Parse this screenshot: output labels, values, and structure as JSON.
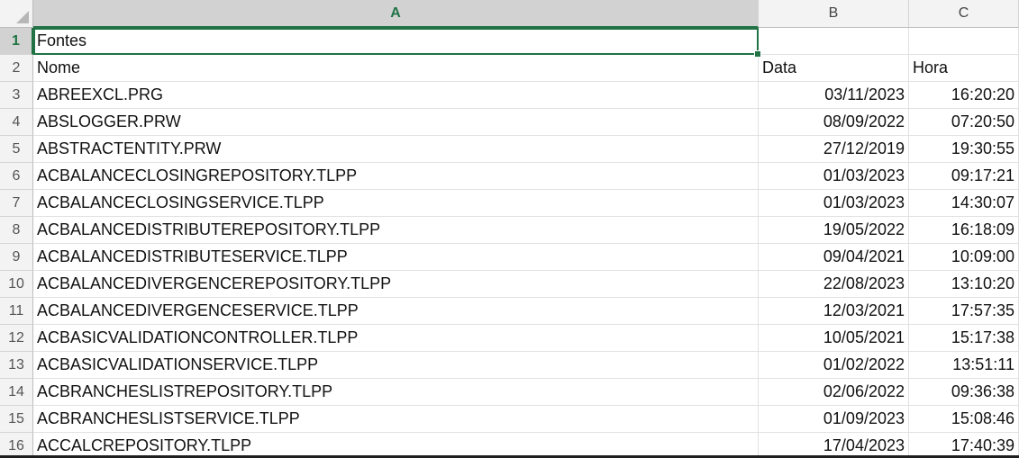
{
  "columns": [
    "A",
    "B",
    "C"
  ],
  "rows": [
    {
      "num": "1",
      "a": "Fontes",
      "b": "",
      "c": ""
    },
    {
      "num": "2",
      "a": "Nome",
      "b": "Data",
      "c": "Hora"
    },
    {
      "num": "3",
      "a": "ABREEXCL.PRG",
      "b": "03/11/2023",
      "c": "16:20:20"
    },
    {
      "num": "4",
      "a": "ABSLOGGER.PRW",
      "b": "08/09/2022",
      "c": "07:20:50"
    },
    {
      "num": "5",
      "a": "ABSTRACTENTITY.PRW",
      "b": "27/12/2019",
      "c": "19:30:55"
    },
    {
      "num": "6",
      "a": "ACBALANCECLOSINGREPOSITORY.TLPP",
      "b": "01/03/2023",
      "c": "09:17:21"
    },
    {
      "num": "7",
      "a": "ACBALANCECLOSINGSERVICE.TLPP",
      "b": "01/03/2023",
      "c": "14:30:07"
    },
    {
      "num": "8",
      "a": "ACBALANCEDISTRIBUTEREPOSITORY.TLPP",
      "b": "19/05/2022",
      "c": "16:18:09"
    },
    {
      "num": "9",
      "a": "ACBALANCEDISTRIBUTESERVICE.TLPP",
      "b": "09/04/2021",
      "c": "10:09:00"
    },
    {
      "num": "10",
      "a": "ACBALANCEDIVERGENCEREPOSITORY.TLPP",
      "b": "22/08/2023",
      "c": "13:10:20"
    },
    {
      "num": "11",
      "a": "ACBALANCEDIVERGENCESERVICE.TLPP",
      "b": "12/03/2021",
      "c": "17:57:35"
    },
    {
      "num": "12",
      "a": "ACBASICVALIDATIONCONTROLLER.TLPP",
      "b": "10/05/2021",
      "c": "15:17:38"
    },
    {
      "num": "13",
      "a": "ACBASICVALIDATIONSERVICE.TLPP",
      "b": "01/02/2022",
      "c": "13:51:11"
    },
    {
      "num": "14",
      "a": "ACBRANCHESLISTREPOSITORY.TLPP",
      "b": "02/06/2022",
      "c": "09:36:38"
    },
    {
      "num": "15",
      "a": "ACBRANCHESLISTSERVICE.TLPP",
      "b": "01/09/2023",
      "c": "15:08:46"
    },
    {
      "num": "16",
      "a": "ACCALCREPOSITORY.TLPP",
      "b": "17/04/2023",
      "c": "17:40:39"
    }
  ],
  "active_cell": "A1",
  "colors": {
    "selection": "#217346",
    "header_bg": "#f3f3f3",
    "gridline": "#e1e1e1"
  }
}
